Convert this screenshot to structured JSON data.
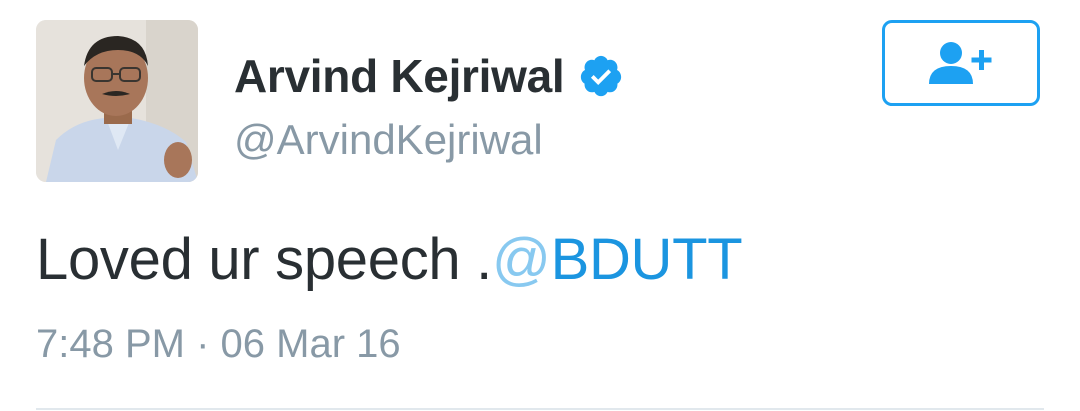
{
  "author": {
    "display_name": "Arvind Kejriwal",
    "handle": "@ArvindKejriwal",
    "verified": true,
    "avatar_icon": "profile-photo"
  },
  "follow_button": {
    "icon": "add-user-icon"
  },
  "tweet": {
    "text": "Loved ur speech .",
    "mention_at": "@",
    "mention_name": "BDUTT"
  },
  "meta": {
    "time": "7:48 PM",
    "separator": "·",
    "date": "06 Mar 16"
  },
  "colors": {
    "accent": "#1da1f2",
    "text": "#292f33",
    "secondary_text": "#8899a6",
    "link": "#1b95e0",
    "divider": "#e1e8ed"
  }
}
